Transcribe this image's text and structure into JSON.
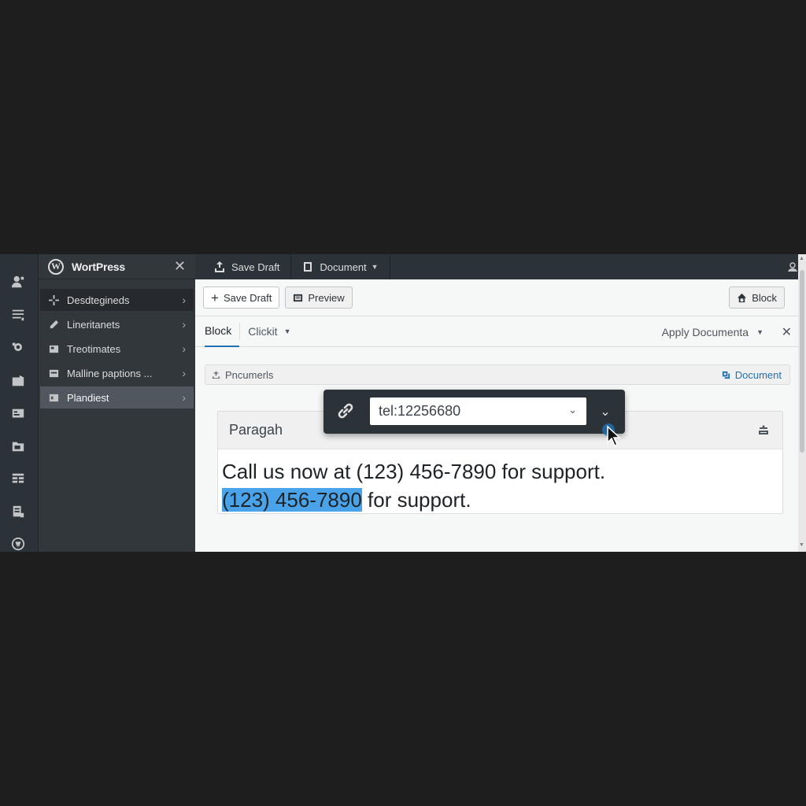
{
  "sidebar": {
    "title": "WortPress",
    "items": [
      {
        "label": "Desdtegineds",
        "icon": "sparkle-icon"
      },
      {
        "label": "Lineritanets",
        "icon": "pencil-icon"
      },
      {
        "label": "Treotimates",
        "icon": "template-icon"
      },
      {
        "label": "Malline paptions ...",
        "icon": "layout-icon"
      },
      {
        "label": "Plandiest",
        "icon": "plugin-icon"
      }
    ]
  },
  "topbar": {
    "save_draft": "Save Draft",
    "document": "Document"
  },
  "toolbar": {
    "save_draft": "Save Draft",
    "preview": "Preview",
    "block": "Block"
  },
  "tabs": {
    "block": "Block",
    "clickit": "Clickit",
    "apply": "Apply Documenta"
  },
  "docbar": {
    "label": "Pncumerls",
    "link": "Document"
  },
  "block": {
    "heading": "Paragah",
    "line1": "Call us now at (123) 456-7890 for support.",
    "highlighted": "(123) 456-7890",
    "line2_rest": " for support."
  },
  "link_popover": {
    "url_value": "tel:12256680"
  },
  "colors": {
    "accent": "#2271b1",
    "highlight": "#4aa3e8",
    "sidebar_bg": "#32373c",
    "rail_bg": "#2c3338"
  }
}
